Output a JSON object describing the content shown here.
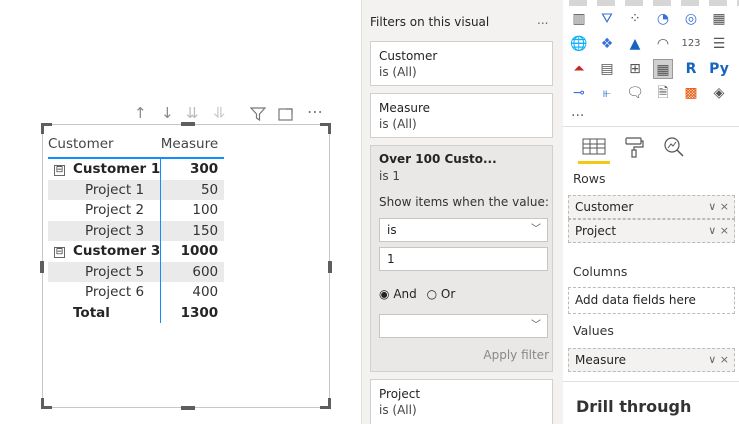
{
  "visual_header": {
    "icons": [
      "arrow-up-icon",
      "arrow-down-icon",
      "drill-down-icon",
      "expand-hierarchy-icon",
      "filter-icon",
      "focus-mode-icon",
      "more-options-icon"
    ]
  },
  "matrix": {
    "col_customer": "Customer",
    "col_measure": "Measure",
    "groups": [
      {
        "name": "Customer 1",
        "value": "300",
        "expander": "⊟",
        "rows": [
          {
            "name": "Project 1",
            "value": "50"
          },
          {
            "name": "Project 2",
            "value": "100"
          },
          {
            "name": "Project 3",
            "value": "150"
          }
        ]
      },
      {
        "name": "Customer 3",
        "value": "1000",
        "expander": "⊟",
        "rows": [
          {
            "name": "Project 5",
            "value": "600"
          },
          {
            "name": "Project 6",
            "value": "400"
          }
        ]
      }
    ],
    "total_label": "Total",
    "total_value": "1300"
  },
  "filters": {
    "header": "Filters on this visual",
    "more": "...",
    "customer_title": "Customer",
    "customer_sub": "is (All)",
    "measure_title": "Measure",
    "measure_sub": "is (All)",
    "over_title": "Over 100 Custo...",
    "over_sub": "is 1",
    "show_items": "Show items when the value:",
    "condition": "is",
    "value": "1",
    "and_label": "And",
    "or_label": "Or",
    "apply": "Apply filter",
    "project_title": "Project",
    "project_sub": "is (All)"
  },
  "viz": {
    "r_label": "R",
    "py_label": "Py",
    "more": "...",
    "rows_label": "Rows",
    "rows_fields": [
      "Customer",
      "Project"
    ],
    "columns_label": "Columns",
    "columns_placeholder": "Add data fields here",
    "values_label": "Values",
    "values_field": "Measure",
    "drill_through": "Drill through",
    "well_chevron": "∨",
    "well_remove": "×"
  },
  "colors": {
    "accent": "#118dff",
    "brand_yellow": "#f2c811"
  }
}
